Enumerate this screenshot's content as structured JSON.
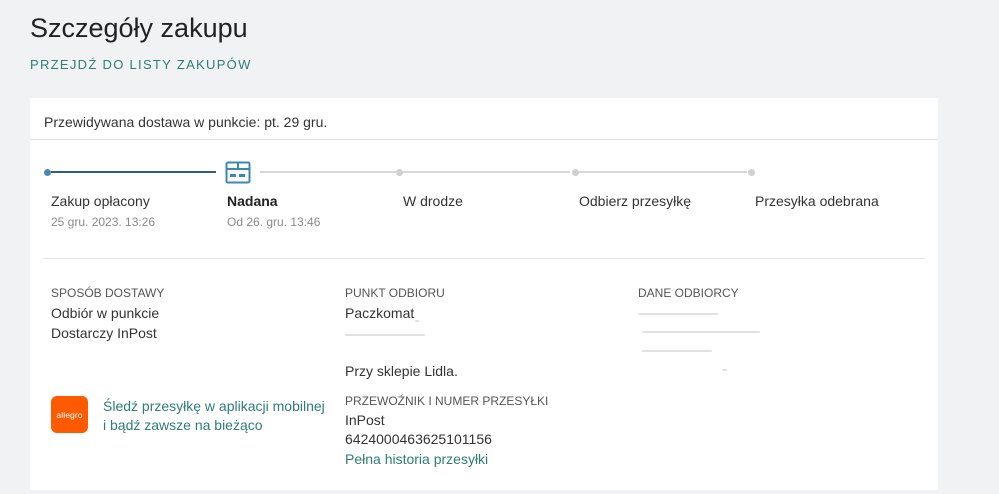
{
  "page": {
    "title": "Szczegóły zakupu",
    "back_link": "PRZEJDŹ DO LISTY ZAKUPÓW"
  },
  "card": {
    "delivery_estimate": "Przewidywana dostawa w punkcie: pt. 29 gru.",
    "steps": [
      {
        "label": "Zakup opłacony",
        "sub": "25 gru. 2023. 13:26",
        "state": "done"
      },
      {
        "label": "Nadana",
        "sub": "Od 26. gru. 13:46",
        "state": "current"
      },
      {
        "label": "W drodze",
        "state": "pending"
      },
      {
        "label": "Odbierz przesyłkę",
        "state": "pending"
      },
      {
        "label": "Przesyłka odebrana",
        "state": "pending"
      }
    ],
    "delivery_method": {
      "heading": "SPOSÓB DOSTAWY",
      "line1": "Odbiór w punkcie",
      "line2": "Dostarczy InPost"
    },
    "pickup_point": {
      "heading": "PUNKT ODBIORU",
      "name": "Paczkomat",
      "note": "Przy sklepie Lidla."
    },
    "carrier": {
      "heading": "PRZEWOŹNIK I NUMER PRZESYŁKI",
      "name": "InPost",
      "tracking_number": "6424000463625101156",
      "history_link": "Pełna historia przesyłki"
    },
    "recipient": {
      "heading": "DANE ODBIORCY"
    },
    "app_promo": {
      "logo_text": "allegro",
      "line1": "Śledź przesyłkę w aplikacji mobilnej",
      "line2": "i bądź zawsze na bieżąco"
    },
    "icons": {
      "current_step": "package-icon"
    }
  },
  "colors": {
    "accent": "#2e7d77",
    "track-active": "#2f5f7a",
    "dot-active": "#4a87b4",
    "icon": "#3c88b0",
    "logo-bg": "#ff5a00"
  }
}
